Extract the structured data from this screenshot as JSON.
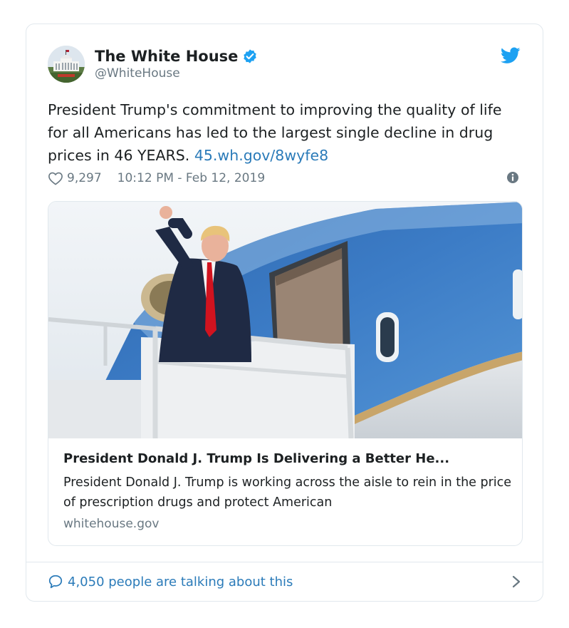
{
  "author": {
    "name": "The White House",
    "handle": "@WhiteHouse",
    "verified": true
  },
  "tweet": {
    "text": "President Trump's commitment to improving the quality of life for all Americans has led to the largest single decline in drug prices in 46 YEARS.",
    "link": "45.wh.gov/8wyfe8",
    "likes": "9,297",
    "timestamp": "10:12 PM - Feb 12, 2019"
  },
  "link_card": {
    "title": "President Donald J. Trump Is Delivering a Better He...",
    "description": "President Donald J. Trump is working across the aisle to rein in the price of prescription drugs and protect American",
    "domain": "whitehouse.gov"
  },
  "footer": {
    "talking": "4,050 people are talking about this"
  },
  "icons": {
    "verified": "verified-badge-icon",
    "twitter": "twitter-bird-icon",
    "like": "heart-icon",
    "info": "info-icon",
    "reply": "speech-bubble-icon",
    "next": "chevron-right-icon"
  },
  "colors": {
    "link": "#2b7bb9",
    "verified": "#1da1f2",
    "muted": "#697882",
    "border": "#e1e8ed"
  }
}
